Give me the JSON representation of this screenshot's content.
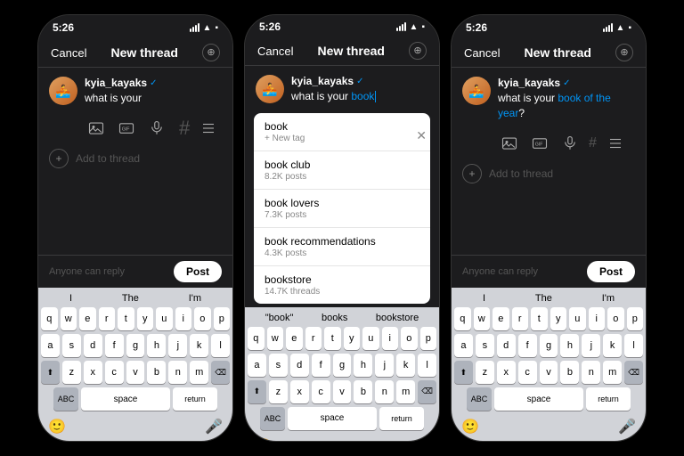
{
  "phones": [
    {
      "id": "phone1",
      "statusBar": {
        "time": "5:26",
        "signal": "●●●",
        "wifi": "wifi",
        "battery": "battery"
      },
      "header": {
        "cancel": "Cancel",
        "title": "New thread",
        "icon": "⊕"
      },
      "thread": {
        "username": "kyia_kayaks",
        "verified": true,
        "text": "what is your",
        "textSuffix": ""
      },
      "replyLabel": "Anyone can reply",
      "postLabel": "Post",
      "keyboard": {
        "suggestions": [
          "I",
          "The",
          "I'm"
        ],
        "rows": [
          [
            "q",
            "w",
            "e",
            "r",
            "t",
            "y",
            "u",
            "i",
            "o",
            "p"
          ],
          [
            "a",
            "s",
            "d",
            "f",
            "g",
            "h",
            "j",
            "k",
            "l"
          ],
          [
            "z",
            "x",
            "c",
            "v",
            "b",
            "n",
            "m"
          ],
          [
            "ABC",
            "space",
            "return"
          ]
        ]
      }
    },
    {
      "id": "phone2",
      "statusBar": {
        "time": "5:26"
      },
      "header": {
        "cancel": "Cancel",
        "title": "New thread",
        "icon": "⊕"
      },
      "thread": {
        "username": "kyia_kayaks",
        "verified": true,
        "text": "what is your ",
        "typed": "book",
        "textSuffix": ""
      },
      "autocomplete": [
        {
          "main": "book",
          "sub": "+ New tag"
        },
        {
          "main": "book club",
          "sub": "8.2K posts"
        },
        {
          "main": "book lovers",
          "sub": "7.3K posts"
        },
        {
          "main": "book recommendations",
          "sub": "4.3K posts"
        },
        {
          "main": "bookstore",
          "sub": "14.7K threads"
        }
      ],
      "replyLabel": "Anyone can reply",
      "postLabel": "Post",
      "keyboard": {
        "suggestions": [
          "\"book\"",
          "books",
          "bookstore"
        ],
        "rows": [
          [
            "q",
            "w",
            "e",
            "r",
            "t",
            "y",
            "u",
            "i",
            "o",
            "p"
          ],
          [
            "a",
            "s",
            "d",
            "f",
            "g",
            "h",
            "j",
            "k",
            "l"
          ],
          [
            "z",
            "x",
            "c",
            "v",
            "b",
            "n",
            "m"
          ],
          [
            "ABC",
            "space",
            "return"
          ]
        ]
      }
    },
    {
      "id": "phone3",
      "statusBar": {
        "time": "5:26"
      },
      "header": {
        "cancel": "Cancel",
        "title": "New thread",
        "icon": "⊕"
      },
      "thread": {
        "username": "kyia_kayaks",
        "verified": true,
        "text": "what is your ",
        "highlight": "book of the year",
        "textSuffix": "?"
      },
      "replyLabel": "Anyone can reply",
      "postLabel": "Post",
      "keyboard": {
        "suggestions": [
          "I",
          "The",
          "I'm"
        ],
        "rows": [
          [
            "q",
            "w",
            "e",
            "r",
            "t",
            "y",
            "u",
            "i",
            "o",
            "p"
          ],
          [
            "a",
            "s",
            "d",
            "f",
            "g",
            "h",
            "j",
            "k",
            "l"
          ],
          [
            "z",
            "x",
            "c",
            "v",
            "b",
            "n",
            "m"
          ],
          [
            "ABC",
            "space",
            "return"
          ]
        ]
      }
    }
  ]
}
